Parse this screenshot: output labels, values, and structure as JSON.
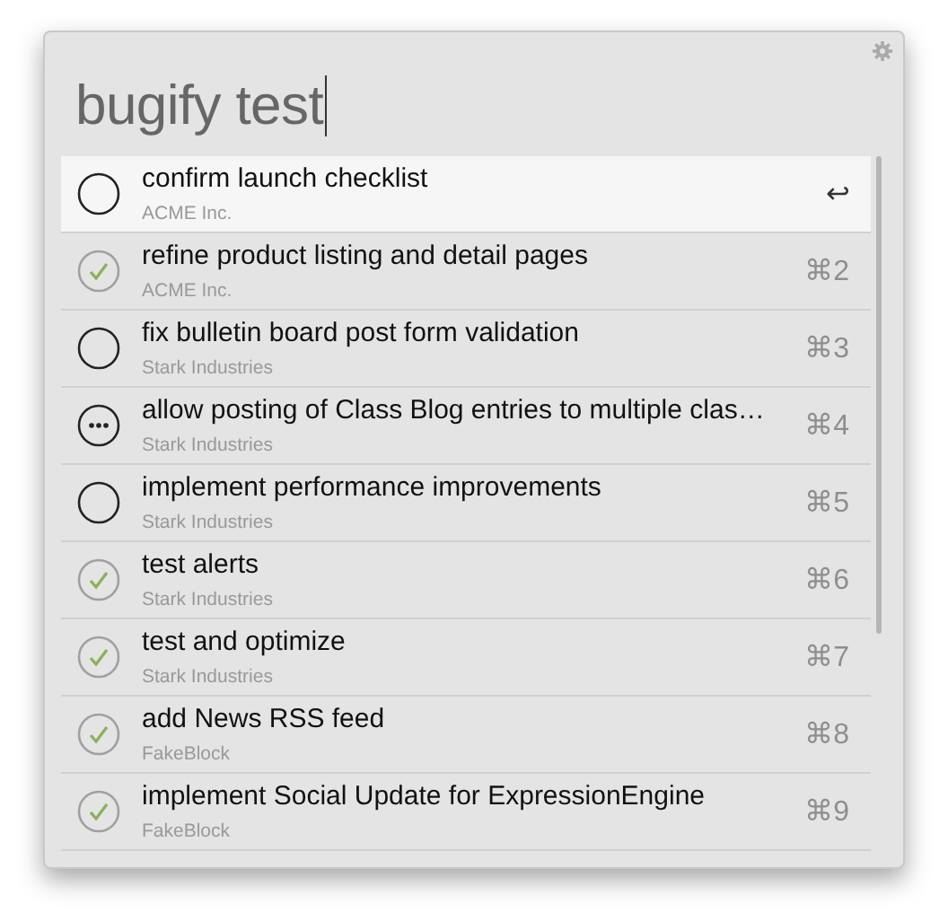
{
  "search": {
    "value": "bugify test"
  },
  "results": [
    {
      "title": "confirm launch checklist",
      "project": "ACME Inc.",
      "kind": "open",
      "shortcut": "↩",
      "selected": true
    },
    {
      "title": "refine product listing and detail pages",
      "project": "ACME Inc.",
      "kind": "done",
      "shortcut": "⌘2",
      "selected": false
    },
    {
      "title": "fix bulletin board post form validation",
      "project": "Stark Industries",
      "kind": "open",
      "shortcut": "⌘3",
      "selected": false
    },
    {
      "title": "allow posting of Class Blog entries to multiple clas…",
      "project": "Stark Industries",
      "kind": "pending",
      "shortcut": "⌘4",
      "selected": false
    },
    {
      "title": "implement performance improvements",
      "project": "Stark Industries",
      "kind": "open",
      "shortcut": "⌘5",
      "selected": false
    },
    {
      "title": "test alerts",
      "project": "Stark Industries",
      "kind": "done",
      "shortcut": "⌘6",
      "selected": false
    },
    {
      "title": "test and optimize",
      "project": "Stark Industries",
      "kind": "done",
      "shortcut": "⌘7",
      "selected": false
    },
    {
      "title": "add News RSS feed",
      "project": "FakeBlock",
      "kind": "done",
      "shortcut": "⌘8",
      "selected": false
    },
    {
      "title": "implement Social Update for ExpressionEngine",
      "project": "FakeBlock",
      "kind": "done",
      "shortcut": "⌘9",
      "selected": false
    }
  ]
}
